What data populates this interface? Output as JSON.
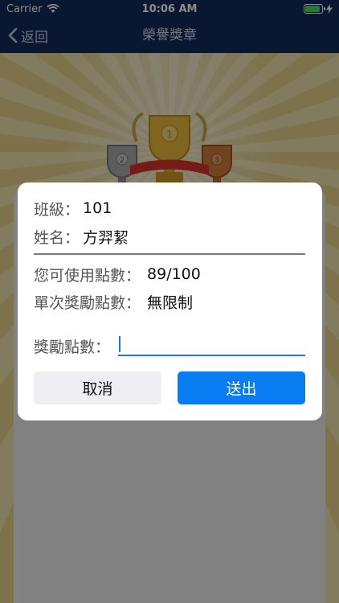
{
  "status_bar": {
    "carrier": "Carrier",
    "time": "10:06 AM",
    "battery_level": 0.9
  },
  "nav": {
    "back_label": "返回",
    "title": "榮譽獎章"
  },
  "dialog": {
    "class_label": "班級：",
    "class_value": "101",
    "name_label": "姓名：",
    "name_value": "方羿絜",
    "available_points_label": "您可使用點數：",
    "available_points_value": "89/100",
    "single_reward_label": "單次獎勵點數：",
    "single_reward_value": "無限制",
    "reward_points_label": "獎勵點數：",
    "reward_points_value": "",
    "cancel_label": "取消",
    "submit_label": "送出"
  },
  "colors": {
    "nav_bg": "#122a5b",
    "primary": "#0a7cf2",
    "input_underline": "#1f78d1"
  },
  "icons": [
    "wifi-icon",
    "battery-icon",
    "charging-icon",
    "chevron-left-icon",
    "trophy-icon"
  ]
}
